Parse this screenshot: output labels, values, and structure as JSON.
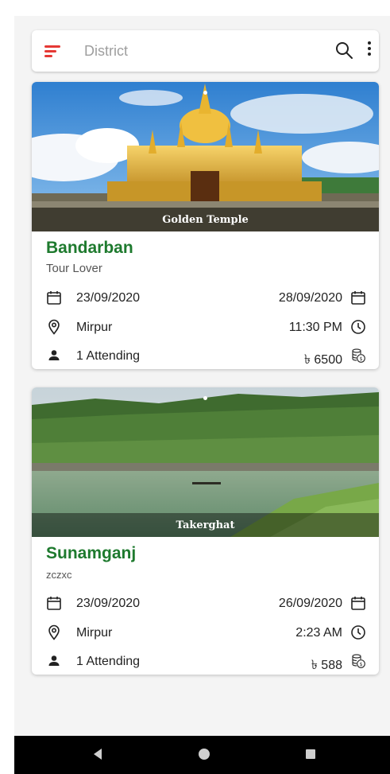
{
  "search": {
    "placeholder": "District"
  },
  "cards": [
    {
      "image_caption": "Golden Temple",
      "title": "Bandarban",
      "subtitle": "Tour Lover",
      "start_date": "23/09/2020",
      "end_date": "28/09/2020",
      "location": "Mirpur",
      "time": "11:30 PM",
      "attending": "1 Attending",
      "price": "৳ 6500"
    },
    {
      "image_caption": "Takerghat",
      "title": "Sunamganj",
      "subtitle": "zczxc",
      "start_date": "23/09/2020",
      "end_date": "26/09/2020",
      "location": "Mirpur",
      "time": "2:23 AM",
      "attending": "1 Attending",
      "price": "৳ 588"
    }
  ],
  "icons": {
    "menu": "menu-icon",
    "search": "search-icon",
    "more": "more-vert-icon",
    "calendar": "calendar-icon",
    "location": "location-pin-icon",
    "clock": "clock-icon",
    "person": "person-icon",
    "money": "money-stack-icon"
  },
  "colors": {
    "accent": "#e53935",
    "title_green": "#1e7a2e"
  }
}
